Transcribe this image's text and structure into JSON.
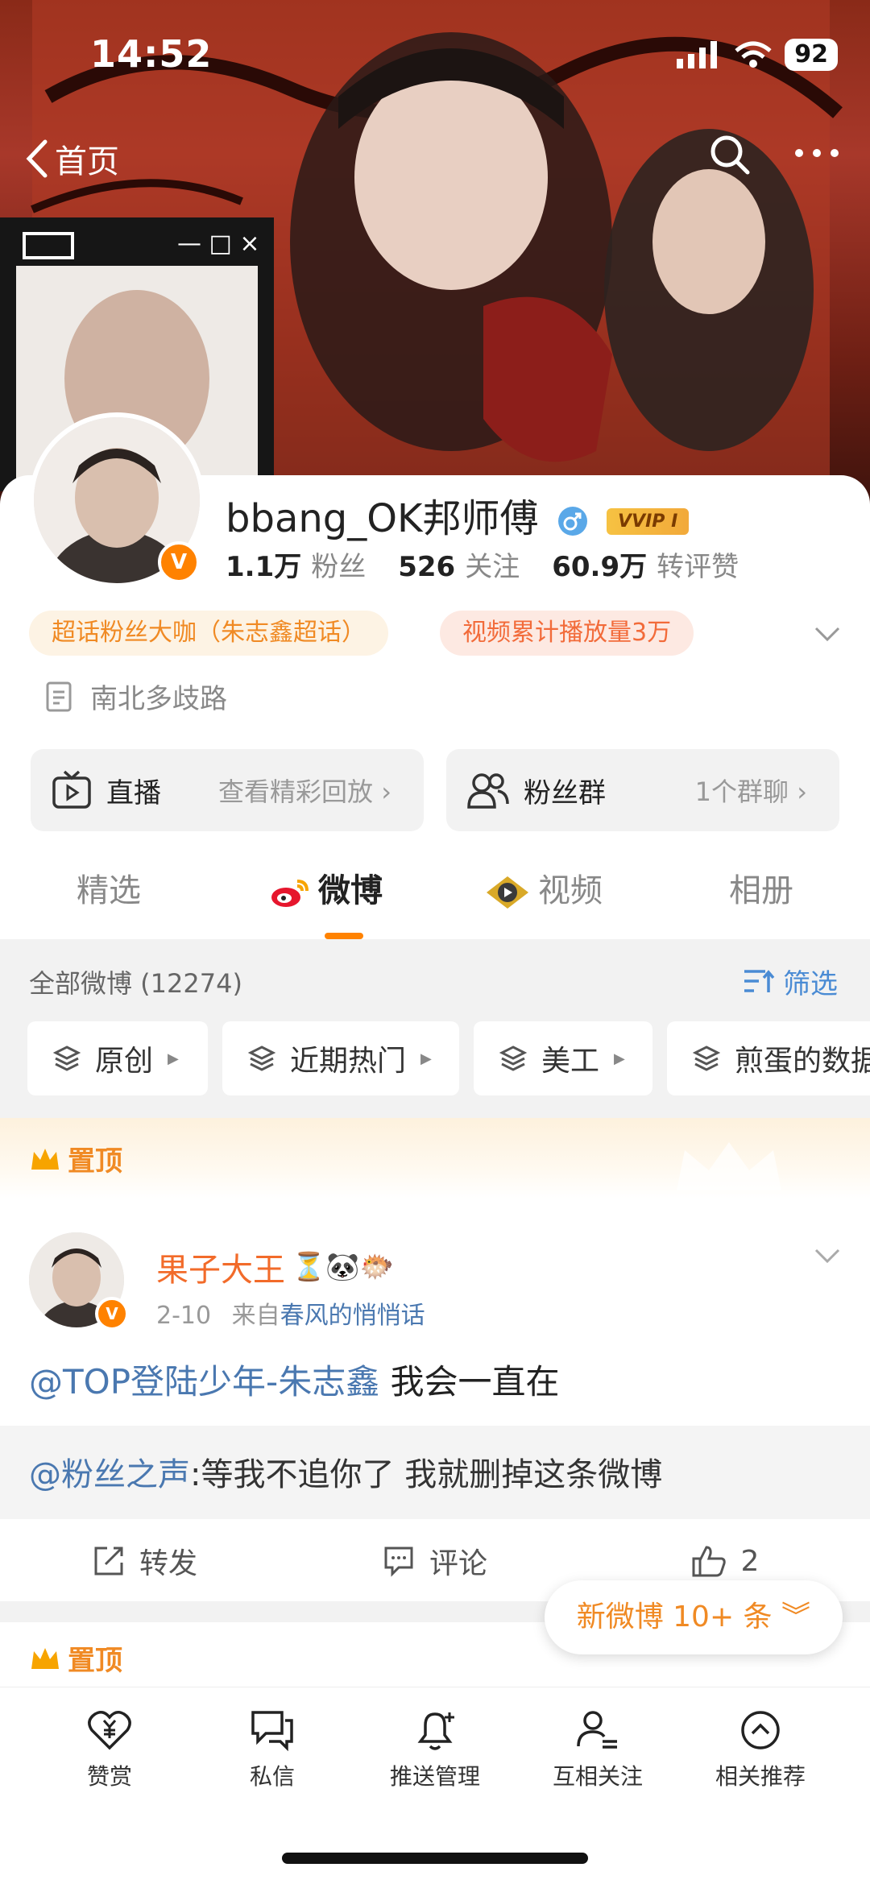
{
  "status": {
    "time": "14:52",
    "battery": "92"
  },
  "topbar": {
    "back_label": "首页"
  },
  "profile": {
    "username": "bbang_OK邦师傅",
    "vip_badge": "VVIP I",
    "followers_value": "1.1万",
    "followers_label": "粉丝",
    "following_value": "526",
    "following_label": "关注",
    "likes_value": "60.9万",
    "likes_label": "转评赞",
    "tag1": "超话粉丝大咖（朱志鑫超话）",
    "tag2": "视频累计播放量3万",
    "location": "南北多歧路",
    "live_title": "直播",
    "live_sub": "查看精彩回放 ›",
    "fans_title": "粉丝群",
    "fans_sub": "1个群聊 ›"
  },
  "tabs": [
    "精选",
    "微博",
    "视频",
    "相册"
  ],
  "filter": {
    "all_label": "全部微博 (12274)",
    "filter_label": "筛选",
    "chips": [
      "原创",
      "近期热门",
      "美工",
      "煎蛋的数据"
    ]
  },
  "pinned_label": "置顶",
  "post": {
    "author": "果子大王",
    "author_emojis": "⏳🐼🐡",
    "date": "2-10",
    "source_prefix": "来自",
    "source": "春风的悄悄话",
    "mention": "@TOP登陆少年-朱志鑫",
    "text": " 我会一直在",
    "quote_mention": "@粉丝之声",
    "quote_text": ":等我不追你了 我就删掉这条微博",
    "repost_label": "转发",
    "comment_label": "评论",
    "like_count": "2"
  },
  "new_weibo": "新微博 10+ 条 ︾",
  "bottom_nav": [
    "赞赏",
    "私信",
    "推送管理",
    "互相关注",
    "相关推荐"
  ],
  "colors": {
    "accent": "#ff8200",
    "link": "#4a78b0",
    "tag_text": "#f08a24"
  }
}
